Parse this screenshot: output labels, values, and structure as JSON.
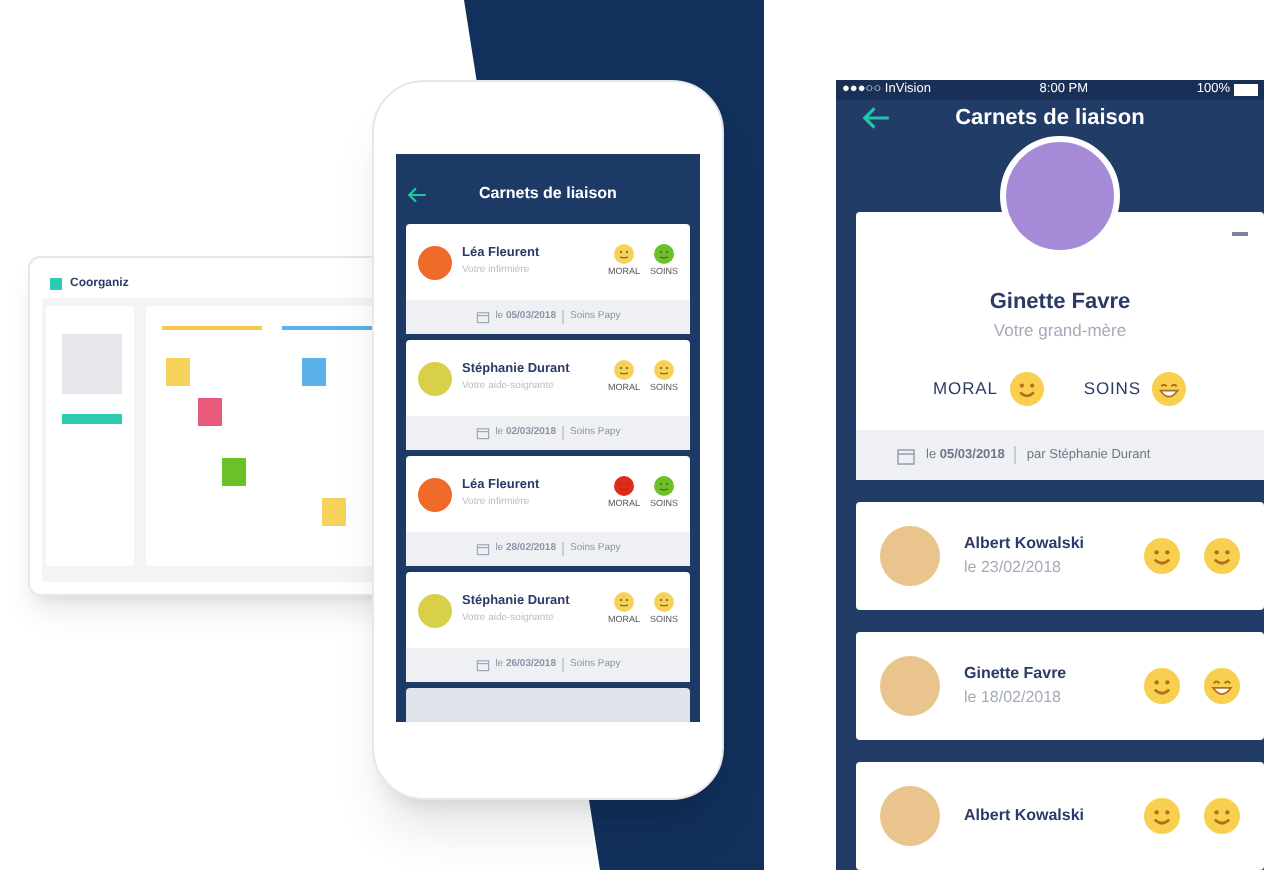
{
  "desktop": {
    "logo": "Coorganiz"
  },
  "phone_left": {
    "title": "Carnets de liaison",
    "cards": [
      {
        "name": "Léa Fleurent",
        "role": "Votre infirmière",
        "avatar": {
          "color": "#f06a2a"
        },
        "moral": {
          "label": "MORAL",
          "color": "#f7d25a"
        },
        "soins": {
          "label": "SOINS",
          "color": "#6cc02a"
        },
        "date": "le **05/03/2018**",
        "tag": "Soins Papy"
      },
      {
        "name": "Stéphanie Durant",
        "role": "Votre aide-soignante",
        "avatar": {
          "color": "#d8cf4a"
        },
        "moral": {
          "label": "MORAL",
          "color": "#f7d25a"
        },
        "soins": {
          "label": "SOINS",
          "color": "#f7d25a"
        },
        "date": "le **02/03/2018**",
        "tag": "Soins Papy"
      },
      {
        "name": "Léa Fleurent",
        "role": "Votre infirmière",
        "avatar": {
          "color": "#f06a2a"
        },
        "moral": {
          "label": "MORAL",
          "color": "#e02a1a"
        },
        "soins": {
          "label": "SOINS",
          "color": "#6cc02a"
        },
        "date": "le **28/02/2018**",
        "tag": "Soins Papy"
      },
      {
        "name": "Stéphanie Durant",
        "role": "Votre aide-soignante",
        "avatar": {
          "color": "#d8cf4a"
        },
        "moral": {
          "label": "MORAL",
          "color": "#f7d25a"
        },
        "soins": {
          "label": "SOINS",
          "color": "#f7d25a"
        },
        "date": "le **26/03/2018**",
        "tag": "Soins Papy"
      }
    ]
  },
  "phone_right": {
    "status_bar": {
      "carrier": "●●●○○ InVision",
      "time": "8:00 PM",
      "battery": "100%"
    },
    "title": "Carnets de liaison",
    "profile": {
      "name": "Ginette Favre",
      "relation": "Votre grand-mère",
      "moral": {
        "label": "MORAL",
        "kind": "smile"
      },
      "soins": {
        "label": "SOINS",
        "kind": "grin"
      },
      "date": "le **05/03/2018**",
      "author": "par Stéphanie Durant"
    },
    "entries": [
      {
        "name": "Albert Kowalski",
        "date": "le 23/02/2018",
        "moral": {
          "kind": "smile"
        },
        "soins": {
          "kind": "smile"
        }
      },
      {
        "name": "Ginette Favre",
        "date": "le 18/02/2018",
        "moral": {
          "kind": "smile"
        },
        "soins": {
          "kind": "grin"
        }
      },
      {
        "name": "Albert Kowalski",
        "moral": {
          "kind": "smile"
        },
        "soins": {
          "kind": "smile"
        }
      }
    ]
  }
}
